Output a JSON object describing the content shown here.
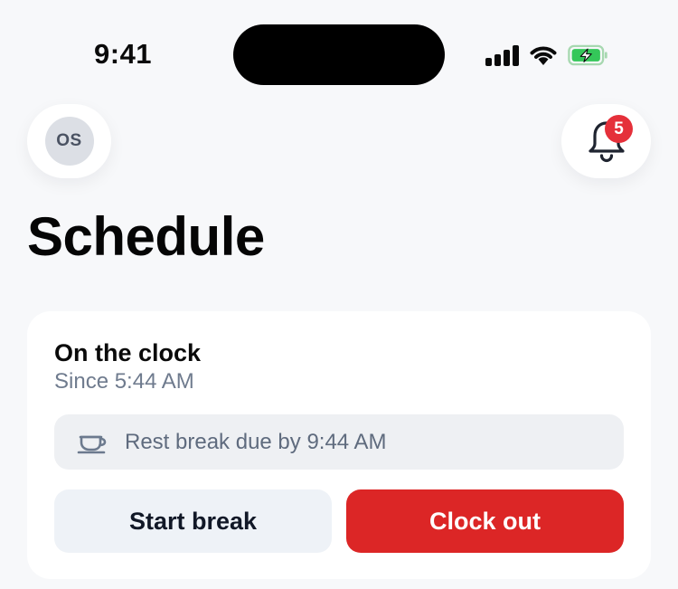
{
  "status_bar": {
    "time": "9:41",
    "battery_color": "#34c759"
  },
  "header": {
    "avatar_initials": "OS",
    "notification_count": "5",
    "badge_color": "#e5303a"
  },
  "page": {
    "title": "Schedule"
  },
  "clock_card": {
    "status": "On the clock",
    "since": "Since 5:44 AM",
    "break_notice": "Rest break due by 9:44 AM",
    "break_icon": "coffee-cup-icon",
    "start_break_label": "Start break",
    "clock_out_label": "Clock out",
    "clock_out_color": "#dc2626"
  }
}
